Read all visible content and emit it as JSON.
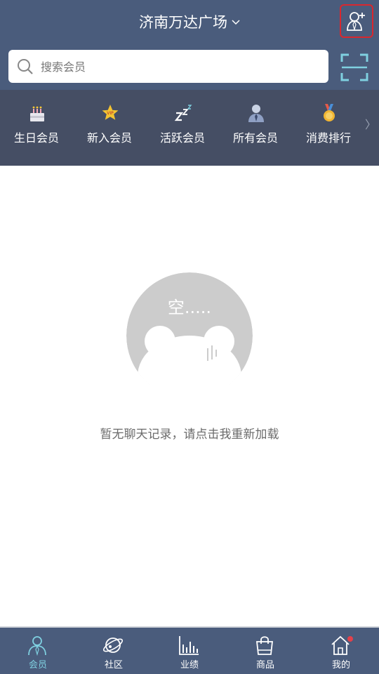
{
  "header": {
    "store_name": "济南万达广场"
  },
  "search": {
    "placeholder": "搜索会员"
  },
  "categories": [
    {
      "label": "生日会员",
      "icon": "birthday-cake-icon"
    },
    {
      "label": "新入会员",
      "icon": "vip-star-icon"
    },
    {
      "label": "活跃会员",
      "icon": "zzz-icon"
    },
    {
      "label": "所有会员",
      "icon": "person-icon"
    },
    {
      "label": "消费排行",
      "icon": "medal-icon"
    }
  ],
  "empty_state": {
    "illustration_text": "空.....",
    "message": "暂无聊天记录，请点击我重新加载"
  },
  "tabbar": [
    {
      "label": "会员",
      "icon": "member-icon",
      "active": true
    },
    {
      "label": "社区",
      "icon": "planet-icon"
    },
    {
      "label": "业绩",
      "icon": "bar-chart-icon"
    },
    {
      "label": "商品",
      "icon": "shopping-bag-icon"
    },
    {
      "label": "我的",
      "icon": "home-icon",
      "badge": true
    }
  ],
  "colors": {
    "header_bg": "#4a5c7c",
    "category_bg": "#454e64",
    "active_tab": "#7fd0e0",
    "highlight_border": "#d9272e",
    "badge": "#e2414b"
  }
}
